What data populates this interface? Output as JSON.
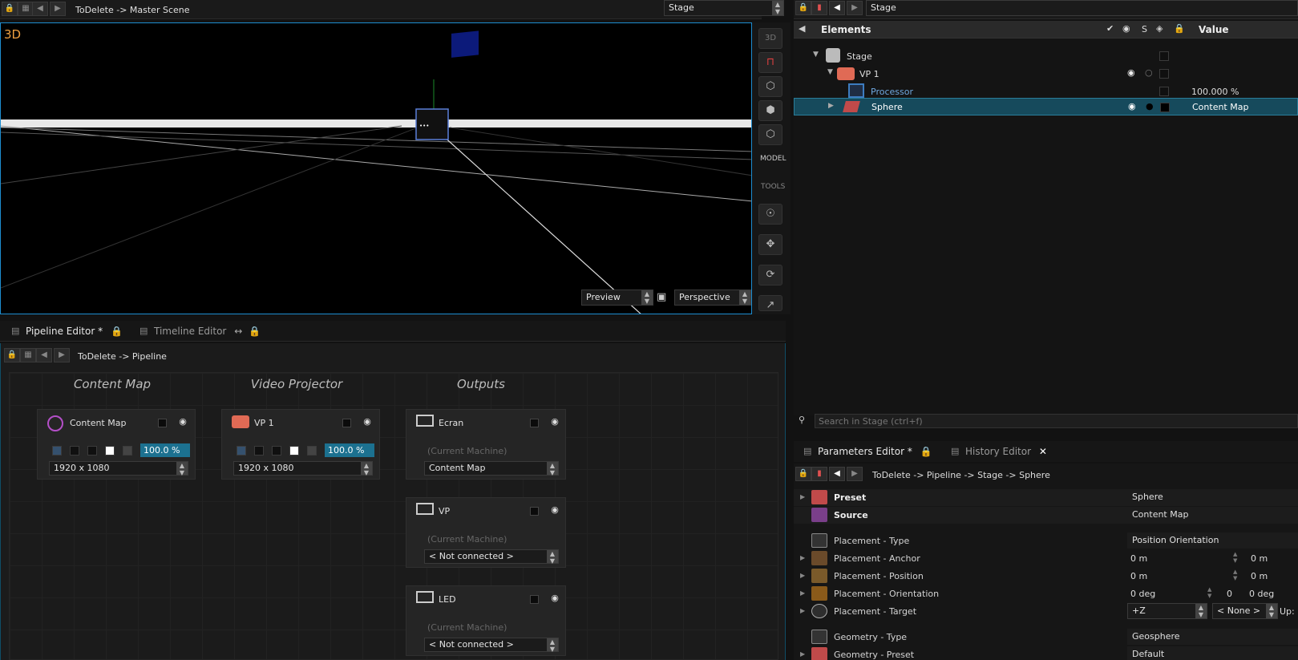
{
  "viewport": {
    "scene_path": "ToDelete -> Master Scene",
    "scene_select": "Stage",
    "mode_label": "3D",
    "preview_select": "Preview",
    "camera_select": "Perspective",
    "side_buttons": [
      "3D",
      "MODEL",
      "TOOLS"
    ]
  },
  "elements_panel": {
    "top_select": "Stage",
    "header_elements": "Elements",
    "header_s": "S",
    "header_value": "Value",
    "rows": [
      {
        "label": "Stage",
        "value": ""
      },
      {
        "label": "VP 1",
        "value": ""
      },
      {
        "label": "Processor",
        "value": "100.000 %"
      },
      {
        "label": "Sphere",
        "value": "Content Map"
      }
    ],
    "search_placeholder": "Search in Stage (ctrl+f)"
  },
  "pipeline": {
    "tabs": [
      {
        "label": "Pipeline Editor *"
      },
      {
        "label": "Timeline Editor"
      }
    ],
    "breadcrumb": "ToDelete -> Pipeline",
    "columns": [
      "Content Map",
      "Video Projector",
      "Outputs"
    ],
    "nodes": {
      "content_map": {
        "title": "Content Map",
        "percent": "100.0 %",
        "resolution": "1920 x 1080"
      },
      "vp1": {
        "title": "VP 1",
        "percent": "100.0 %",
        "resolution": "1920 x 1080"
      },
      "outputs": [
        {
          "title": "Ecran",
          "machine": "(Current Machine)",
          "select": "Content Map"
        },
        {
          "title": "VP",
          "machine": "(Current Machine)",
          "select": "< Not connected >"
        },
        {
          "title": "LED",
          "machine": "(Current Machine)",
          "select": "< Not connected >"
        }
      ]
    }
  },
  "params": {
    "tabs": [
      {
        "label": "Parameters Editor *"
      },
      {
        "label": "History Editor"
      }
    ],
    "breadcrumb": "ToDelete -> Pipeline -> Stage -> Sphere",
    "rows": [
      {
        "label": "Preset",
        "value": "Sphere"
      },
      {
        "label": "Source",
        "value": "Content Map"
      },
      {
        "label": "Placement - Type",
        "value": "Position Orientation"
      },
      {
        "label": "Placement - Anchor",
        "value": "0 m",
        "value2": "0 m"
      },
      {
        "label": "Placement - Position",
        "value": "0 m",
        "value2": "0 m"
      },
      {
        "label": "Placement - Orientation",
        "value": "0 deg",
        "value2": "0",
        "value3": "0 deg"
      },
      {
        "label": "Placement - Target",
        "value": "+Z",
        "value2": "< None >",
        "value3": "Up:"
      },
      {
        "label": "Geometry - Type",
        "value": "Geosphere"
      },
      {
        "label": "Geometry - Preset",
        "value": "Default"
      }
    ]
  },
  "colors": {
    "accent": "#1a7ea6",
    "selection": "#164a5c"
  }
}
